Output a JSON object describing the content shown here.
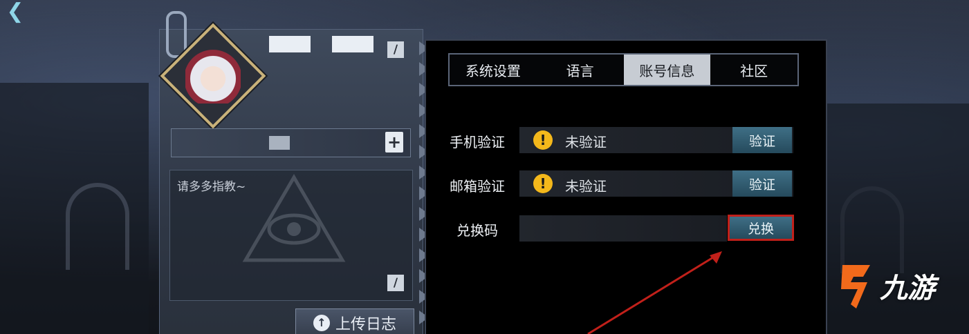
{
  "tabs": [
    {
      "label": "系统设置",
      "active": false
    },
    {
      "label": "语言",
      "active": false
    },
    {
      "label": "账号信息",
      "active": true
    },
    {
      "label": "社区"
    }
  ],
  "profile": {
    "signature": "请多多指教~",
    "upload_label": "上传日志"
  },
  "account": {
    "phone": {
      "label": "手机验证",
      "status": "未验证",
      "button": "验证"
    },
    "email": {
      "label": "邮箱验证",
      "status": "未验证",
      "button": "验证"
    },
    "redeem": {
      "label": "兑换码",
      "input_value": "",
      "button": "兑换"
    }
  },
  "watermark": {
    "text": "九游"
  },
  "colors": {
    "accent": "#3f6f86",
    "warning": "#f4b81b",
    "highlight": "#c1201a",
    "logo_orange": "#f26a1b"
  },
  "icons": {
    "back": "back-arrow-icon",
    "edit": "edit-icon",
    "add": "plus-doc-icon",
    "warning": "warning-icon",
    "upload": "upload-icon"
  }
}
